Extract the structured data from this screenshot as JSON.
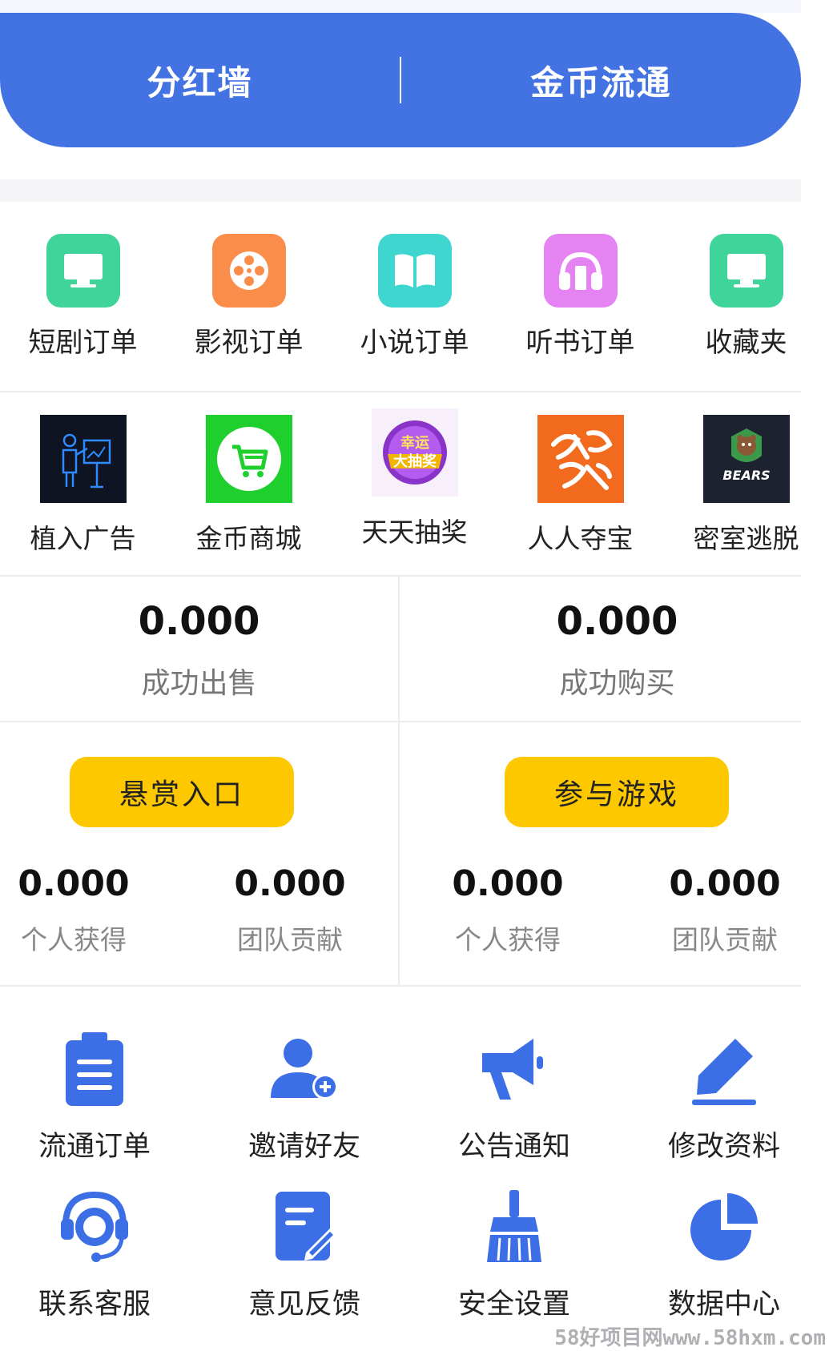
{
  "banner": {
    "left_label": "分红墙",
    "right_label": "金币流通"
  },
  "row1": [
    {
      "label": "短剧订单",
      "icon": "monitor-icon",
      "color": "#3fd499"
    },
    {
      "label": "影视订单",
      "icon": "film-reel-icon",
      "color": "#fb8d4b"
    },
    {
      "label": "小说订单",
      "icon": "book-icon",
      "color": "#3fd6d0"
    },
    {
      "label": "听书订单",
      "icon": "headphones-icon",
      "color": "#e583f3"
    },
    {
      "label": "收藏夹",
      "icon": "monitor-icon",
      "color": "#3fd499"
    }
  ],
  "row2": [
    {
      "label": "植入广告",
      "icon": "presenter-icon"
    },
    {
      "label": "金币商城",
      "icon": "cart-icon"
    },
    {
      "label": "天天抽奖",
      "icon": "lottery-badge",
      "badge_text": "幸运大抽奖"
    },
    {
      "label": "人人夺宝",
      "icon": "treasure-logo"
    },
    {
      "label": "密室逃脱",
      "icon": "bear-logo",
      "badge_text": "BEARS"
    }
  ],
  "stats": {
    "sold_value": "0.000",
    "sold_label": "成功出售",
    "bought_value": "0.000",
    "bought_label": "成功购买"
  },
  "left_panel": {
    "button": "悬赏入口",
    "personal_value": "0.000",
    "personal_label": "个人获得",
    "team_value": "0.000",
    "team_label": "团队贡献"
  },
  "right_panel": {
    "button": "参与游戏",
    "personal_value": "0.000",
    "personal_label": "个人获得",
    "team_value": "0.000",
    "team_label": "团队贡献"
  },
  "menu_row1": [
    {
      "label": "流通订单",
      "icon": "clipboard-icon"
    },
    {
      "label": "邀请好友",
      "icon": "add-user-icon"
    },
    {
      "label": "公告通知",
      "icon": "megaphone-icon"
    },
    {
      "label": "修改资料",
      "icon": "edit-pen-icon"
    }
  ],
  "menu_row2": [
    {
      "label": "联系客服",
      "icon": "headset-agent-icon"
    },
    {
      "label": "意见反馈",
      "icon": "feedback-form-icon"
    },
    {
      "label": "安全设置",
      "icon": "broom-icon"
    },
    {
      "label": "数据中心",
      "icon": "pie-chart-icon"
    }
  ],
  "watermark": "58好项目网www.58hxm.com",
  "colors": {
    "primary_blue": "#4372e3",
    "accent_yellow": "#fec800",
    "icon_blue": "#3c6ee6"
  }
}
